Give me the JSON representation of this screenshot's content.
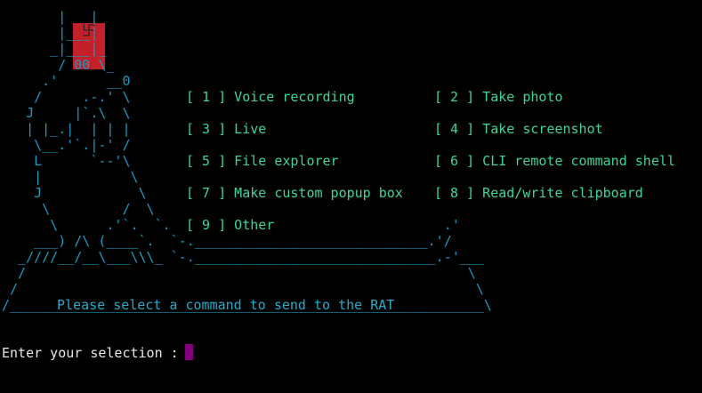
{
  "ascii_art": {
    "symbol": "卐",
    "lines": [
      "       |   |",
      "       |___|",
      "      _|___|_",
      "       / 00 \\_",
      "     .'      __0",
      "    /     .-.' \\",
      "   J     |`.\\  \\",
      "   | |_.|  | | |",
      "    \\__.'`.|-' /",
      "    L      `--'\\",
      "    |           \\",
      "    J            \\",
      "     \\         /  \\",
      "      \\      .'`.  `.                                  .'",
      "    ___) /\\ (____`.  `-._____________________________.'/",
      "  _////__/__\\___\\\\\\_ `-.______________________________.-'___",
      "  /                                                       \\",
      " /                                                         \\",
      "/___________________________________________________________\\"
    ]
  },
  "menu": [
    {
      "label": "[ 1 ] Voice recording"
    },
    {
      "label": "[ 2 ] Take photo"
    },
    {
      "label": "[ 3 ] Live"
    },
    {
      "label": "[ 4 ] Take screenshot"
    },
    {
      "label": "[ 5 ] File explorer"
    },
    {
      "label": "[ 6 ] CLI remote command shell"
    },
    {
      "label": "[ 7 ] Make custom popup box"
    },
    {
      "label": "[ 8 ] Read/write clipboard"
    },
    {
      "label": "[ 9 ] Other"
    }
  ],
  "prompt_message": "Please select a command to send to the RAT",
  "input_prompt": "Enter your selection : ",
  "colors": {
    "background": "#000000",
    "art": "#1c9ac0",
    "menu": "#3fd49a",
    "hat": "#c4202a",
    "cursor": "#800080",
    "input_text": "#e8e8e8"
  }
}
